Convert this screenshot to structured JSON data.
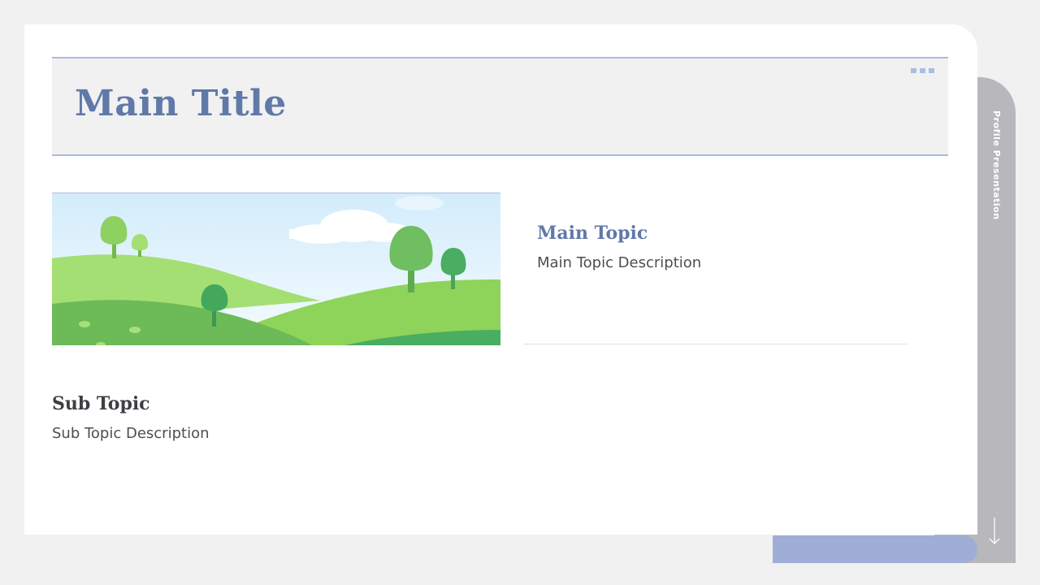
{
  "slide": {
    "title": "Main Title",
    "side_label": "Profile Presentation",
    "main_topic": {
      "heading": "Main Topic",
      "description": "Main Topic Description"
    },
    "sub_topic": {
      "heading": "Sub Topic",
      "description": "Sub Topic Description"
    },
    "image": {
      "subject": "green hills landscape illustration with trees and clouds"
    }
  },
  "icons": {
    "menu": "dots-menu-icon",
    "next": "arrow-down-icon"
  },
  "colors": {
    "background": "#f1f1f2",
    "card": "#ffffff",
    "accent_blue": "#6079a8",
    "line_blue": "#a9bde0",
    "pill_blue": "#9eaed6",
    "tab_grey": "#b8b7bb",
    "text_dark": "#3f3e44",
    "text_body": "#4e4d52"
  }
}
